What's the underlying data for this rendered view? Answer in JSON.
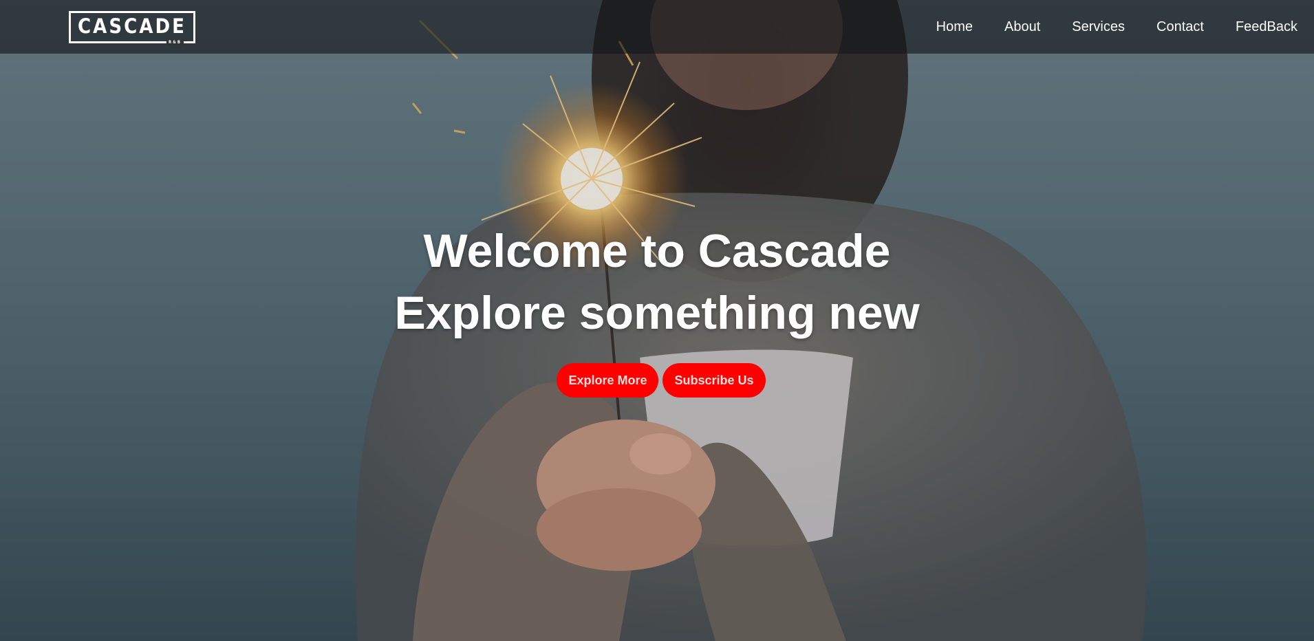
{
  "brand": {
    "logo_text": "CASCADE",
    "logo_subtext": "R&B"
  },
  "nav": {
    "items": [
      {
        "label": "Home"
      },
      {
        "label": "About"
      },
      {
        "label": "Services"
      },
      {
        "label": "Contact"
      },
      {
        "label": "FeedBack"
      }
    ]
  },
  "hero": {
    "title_line1": "Welcome to Cascade",
    "title_line2": "Explore something new",
    "primary_button": "Explore More",
    "secondary_button": "Subscribe Us"
  },
  "colors": {
    "button_bg": "#ff0000",
    "nav_bg": "rgba(20,22,24,0.62)",
    "text": "#ffffff"
  },
  "icons": {
    "background_image": "woman-holding-sparkler-image"
  }
}
